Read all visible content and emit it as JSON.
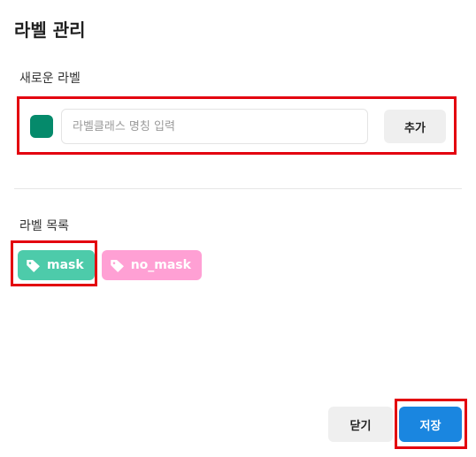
{
  "dialog": {
    "title": "라벨 관리"
  },
  "new_label": {
    "heading": "새로운 라벨",
    "color": "#058a6b",
    "input_value": "",
    "input_placeholder": "라벨클래스 명칭 입력",
    "add_label": "추가"
  },
  "label_list": {
    "heading": "라벨 목록",
    "items": [
      {
        "name": "mask",
        "color": "#4dcbaa",
        "icon": "tag-icon"
      },
      {
        "name": "no_mask",
        "color": "#ffa0d4",
        "icon": "tag-icon"
      }
    ]
  },
  "footer": {
    "close_label": "닫기",
    "save_label": "저장",
    "save_color": "#1a86e0"
  },
  "highlight_color": "#e3000f"
}
